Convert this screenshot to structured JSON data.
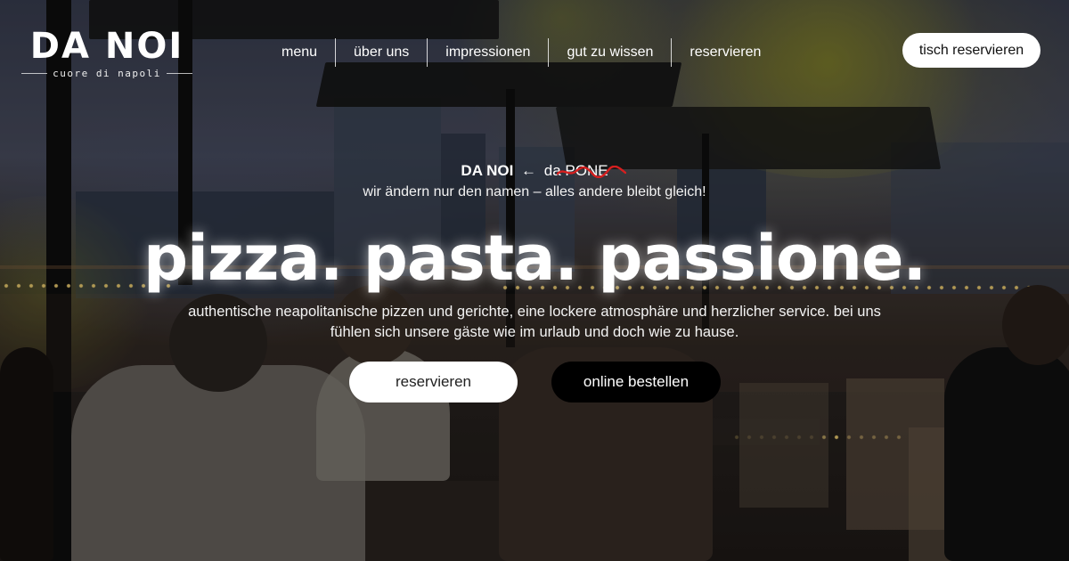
{
  "brand": {
    "name": "DA NOI",
    "tagline": "cuore di napoli"
  },
  "nav": {
    "items": [
      {
        "label": "menu"
      },
      {
        "label": "über uns"
      },
      {
        "label": "impressionen"
      },
      {
        "label": "gut zu wissen"
      },
      {
        "label": "reservieren"
      }
    ]
  },
  "header": {
    "cta_label": "tisch reservieren"
  },
  "announcement": {
    "new_name": "DA NOI",
    "arrow": "←",
    "old_name": "da PONE",
    "subtitle": "wir ändern nur den namen – alles andere bleibt gleich!"
  },
  "hero": {
    "headline": "pizza. pasta. passione.",
    "description": "authentische neapolitanische pizzen und gerichte, eine lockere atmosphäre und herzlicher service. bei uns fühlen sich unsere gäste wie im urlaub und doch wie zu hause.",
    "primary_label": "reservieren",
    "secondary_label": "online bestellen"
  },
  "colors": {
    "strike_red": "#d61f1f",
    "button_white": "#ffffff",
    "button_black": "#000000"
  }
}
